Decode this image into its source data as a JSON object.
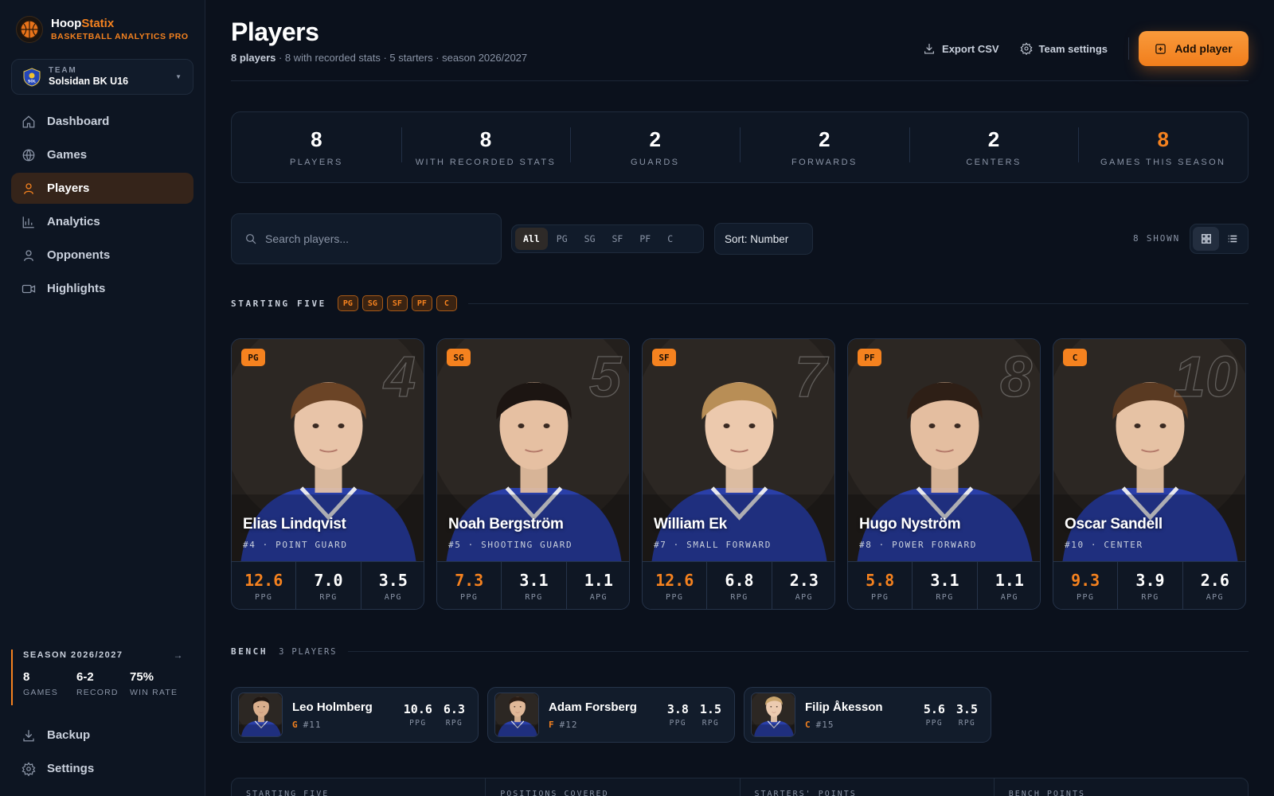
{
  "brand": {
    "name_a": "Hoop",
    "name_b": "Statix",
    "subtitle": "BASKETBALL ANALYTICS PRO"
  },
  "team": {
    "label": "TEAM",
    "name": "Solsidan BK U16",
    "crest_text": "SOL"
  },
  "nav": [
    {
      "label": "Dashboard",
      "icon": "home-icon"
    },
    {
      "label": "Games",
      "icon": "globe-icon"
    },
    {
      "label": "Players",
      "icon": "person-icon",
      "active": true
    },
    {
      "label": "Analytics",
      "icon": "bar-chart-icon"
    },
    {
      "label": "Opponents",
      "icon": "person-icon"
    },
    {
      "label": "Highlights",
      "icon": "video-icon"
    }
  ],
  "season": {
    "title": "SEASON 2026/2027",
    "stats": [
      {
        "value": "8",
        "label": "GAMES"
      },
      {
        "value": "6-2",
        "label": "RECORD"
      },
      {
        "value": "75%",
        "label": "WIN RATE"
      }
    ]
  },
  "bottom_nav": [
    {
      "label": "Backup",
      "icon": "download-icon"
    },
    {
      "label": "Settings",
      "icon": "gear-icon"
    }
  ],
  "header": {
    "title": "Players",
    "subtitle_bold": "8 players",
    "subtitle_rest": " · 8 with recorded stats · 5 starters · season 2026/2027",
    "export_label": "Export CSV",
    "settings_label": "Team settings",
    "add_label": "Add player"
  },
  "summary_stats": [
    {
      "value": "8",
      "label": "PLAYERS"
    },
    {
      "value": "8",
      "label": "WITH RECORDED STATS"
    },
    {
      "value": "2",
      "label": "GUARDS"
    },
    {
      "value": "2",
      "label": "FORWARDS"
    },
    {
      "value": "2",
      "label": "CENTERS"
    },
    {
      "value": "8",
      "label": "GAMES THIS SEASON",
      "highlight": true
    }
  ],
  "toolbar": {
    "search_placeholder": "Search players...",
    "filters": [
      "All",
      "PG",
      "SG",
      "SF",
      "PF",
      "C"
    ],
    "active_filter": "All",
    "sort_label": "Sort: Number",
    "shown": "8 SHOWN"
  },
  "starting_five": {
    "title": "STARTING FIVE",
    "badges": [
      "PG",
      "SG",
      "SF",
      "PF",
      "C"
    ],
    "players": [
      {
        "pos": "PG",
        "number": "4",
        "name": "Elias Lindqvist",
        "role": "#4 · POINT GUARD",
        "ppg": "12.6",
        "rpg": "7.0",
        "apg": "3.5",
        "hair": "#6b4426",
        "skin": "#e8c4a8"
      },
      {
        "pos": "SG",
        "number": "5",
        "name": "Noah Bergström",
        "role": "#5 · SHOOTING GUARD",
        "ppg": "7.3",
        "rpg": "3.1",
        "apg": "1.1",
        "hair": "#1c1512",
        "skin": "#e6c0a2"
      },
      {
        "pos": "SF",
        "number": "7",
        "name": "William Ek",
        "role": "#7 · SMALL FORWARD",
        "ppg": "12.6",
        "rpg": "6.8",
        "apg": "2.3",
        "hair": "#b88e56",
        "skin": "#ecc9ad"
      },
      {
        "pos": "PF",
        "number": "8",
        "name": "Hugo Nyström",
        "role": "#8 · POWER FORWARD",
        "ppg": "5.8",
        "rpg": "3.1",
        "apg": "1.1",
        "hair": "#2e1f16",
        "skin": "#e4bea0"
      },
      {
        "pos": "C",
        "number": "10",
        "name": "Oscar Sandell",
        "role": "#10 · CENTER",
        "ppg": "9.3",
        "rpg": "3.9",
        "apg": "2.6",
        "hair": "#5a3a22",
        "skin": "#e6c2a4"
      }
    ],
    "stat_labels": {
      "ppg": "PPG",
      "rpg": "RPG",
      "apg": "APG"
    }
  },
  "bench": {
    "title": "BENCH",
    "count": "3 PLAYERS",
    "players": [
      {
        "name": "Leo Holmberg",
        "pos": "G",
        "number": "#11",
        "ppg": "10.6",
        "rpg": "6.3",
        "hair": "#1e1612",
        "skin": "#d9ae8c"
      },
      {
        "name": "Adam Forsberg",
        "pos": "F",
        "number": "#12",
        "ppg": "3.8",
        "rpg": "1.5",
        "hair": "#2a1c14",
        "skin": "#e0b898"
      },
      {
        "name": "Filip Åkesson",
        "pos": "C",
        "number": "#15",
        "ppg": "5.6",
        "rpg": "3.5",
        "hair": "#c9a46c",
        "skin": "#eccbb0"
      }
    ],
    "stat_labels": {
      "ppg": "PPG",
      "rpg": "RPG"
    }
  },
  "summary_row": [
    "STARTING FIVE",
    "POSITIONS COVERED",
    "STARTERS' POINTS",
    "BENCH POINTS"
  ],
  "colors": {
    "accent": "#f5821f",
    "background": "#0b111c",
    "jersey": "#2a3fa8"
  }
}
